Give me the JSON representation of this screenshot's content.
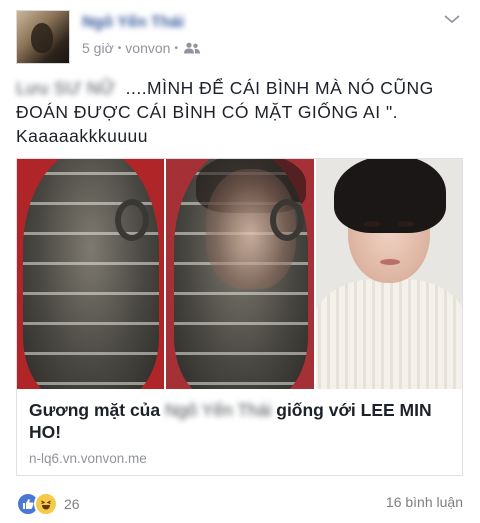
{
  "post": {
    "author_name": "Ngô Yến Thái",
    "time": "5 giờ",
    "via": "vonvon",
    "audience_icon": "friends-icon",
    "text_prefix_blurred": "Lưu  SƯ NỮ",
    "text_line1": "....MÌNH ĐỂ CÁI BÌNH MÀ NÓ CŨNG",
    "text_line2": "ĐOÁN ĐƯỢC CÁI BÌNH CÓ MẶT GIỐNG AI \".",
    "text_line3": "Kaaaaakkkuuuu"
  },
  "link": {
    "title_prefix": "Gương mặt của",
    "title_blurred_name": "Ngô Yến Thái",
    "title_suffix": "giống với LEE MIN",
    "title_line2": "HO!",
    "domain": "n-lq6.vn.vonvon.me"
  },
  "footer": {
    "reaction_count": "26",
    "comments": "16 bình luận"
  },
  "colors": {
    "name_blue": "#365899",
    "meta_gray": "#90949c",
    "like_blue": "#4a77d4",
    "haha_yellow": "#f7c948"
  }
}
